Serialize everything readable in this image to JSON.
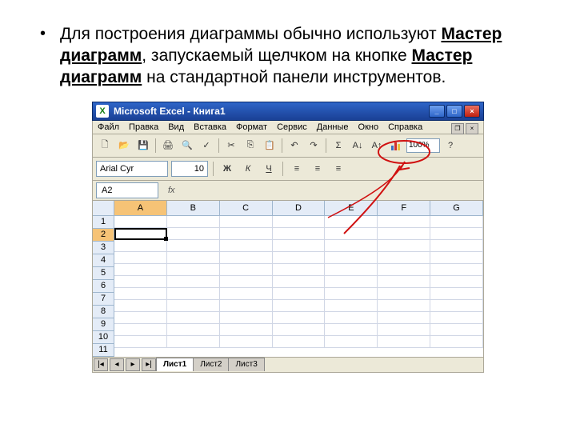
{
  "bullet": {
    "part1": "Для построения диаграммы обычно используют ",
    "bold1": "Мастер диаграмм",
    "part2": ", запускаемый щелчком на кнопке ",
    "bold2": "Мастер диаграмм",
    "part3": " на стандартной панели инструментов."
  },
  "window": {
    "title": "Microsoft Excel - Книга1",
    "menus": [
      "Файл",
      "Правка",
      "Вид",
      "Вставка",
      "Формат",
      "Сервис",
      "Данные",
      "Окно",
      "Справка"
    ],
    "zoom": "100%",
    "font": "Arial Cyr",
    "font_size": "10",
    "bold_glyph": "Ж",
    "namebox": "A2",
    "fx_label": "fx",
    "columns": [
      "A",
      "B",
      "C",
      "D",
      "E",
      "F",
      "G"
    ],
    "rows": [
      "1",
      "2",
      "3",
      "4",
      "5",
      "6",
      "7",
      "8",
      "9",
      "10",
      "11"
    ],
    "sheets": [
      "Лист1",
      "Лист2",
      "Лист3"
    ]
  }
}
